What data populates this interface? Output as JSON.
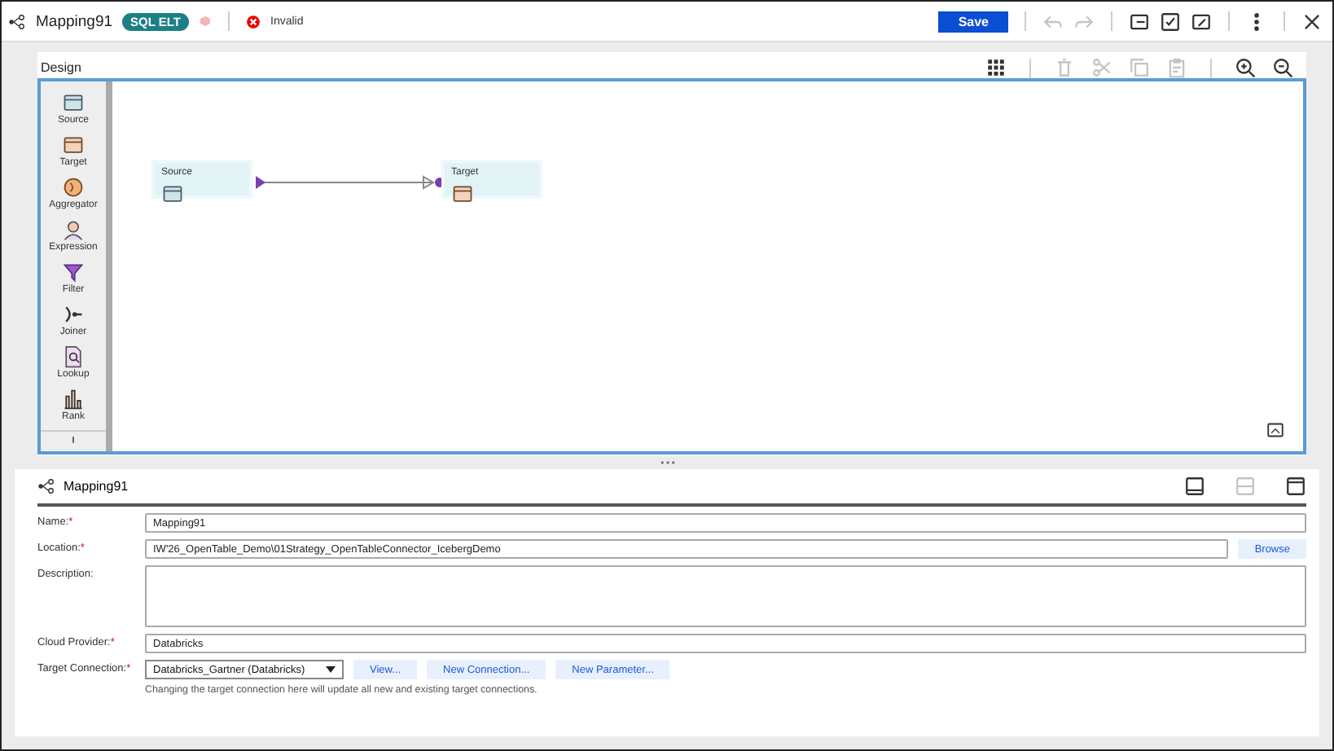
{
  "header": {
    "title": "Mapping91",
    "badge": "SQL ELT",
    "status": "Invalid",
    "save": "Save"
  },
  "design": {
    "title": "Design",
    "palette": [
      {
        "label": "Source",
        "kind": "source"
      },
      {
        "label": "Target",
        "kind": "target"
      },
      {
        "label": "Aggregator",
        "kind": "aggregator"
      },
      {
        "label": "Expression",
        "kind": "expression"
      },
      {
        "label": "Filter",
        "kind": "filter"
      },
      {
        "label": "Joiner",
        "kind": "joiner"
      },
      {
        "label": "Lookup",
        "kind": "lookup"
      },
      {
        "label": "Rank",
        "kind": "rank"
      }
    ],
    "nodes": [
      {
        "label": "Source",
        "kind": "source"
      },
      {
        "label": "Target",
        "kind": "target"
      }
    ]
  },
  "properties": {
    "title": "Mapping91",
    "fields": [
      {
        "kind": "text",
        "label": "Name:",
        "required_mark": "*",
        "value": "Mapping91"
      },
      {
        "kind": "browse",
        "label": "Location:",
        "required_mark": "*",
        "value": "IW'26_OpenTable_Demo\\01Strategy_OpenTableConnector_IcebergDemo",
        "button": "Browse"
      },
      {
        "kind": "textarea",
        "label": "Description:"
      },
      {
        "kind": "text",
        "label": "Cloud Provider:",
        "required_mark": "*",
        "value": "Databricks"
      },
      {
        "kind": "select",
        "label": "Target Connection:",
        "required_mark": "*",
        "value": "Databricks_Gartner (Databricks)",
        "buttons": [
          "View...",
          "New Connection...",
          "New Parameter..."
        ],
        "hint": "Changing the target connection here will update all new and existing target connections."
      }
    ]
  }
}
